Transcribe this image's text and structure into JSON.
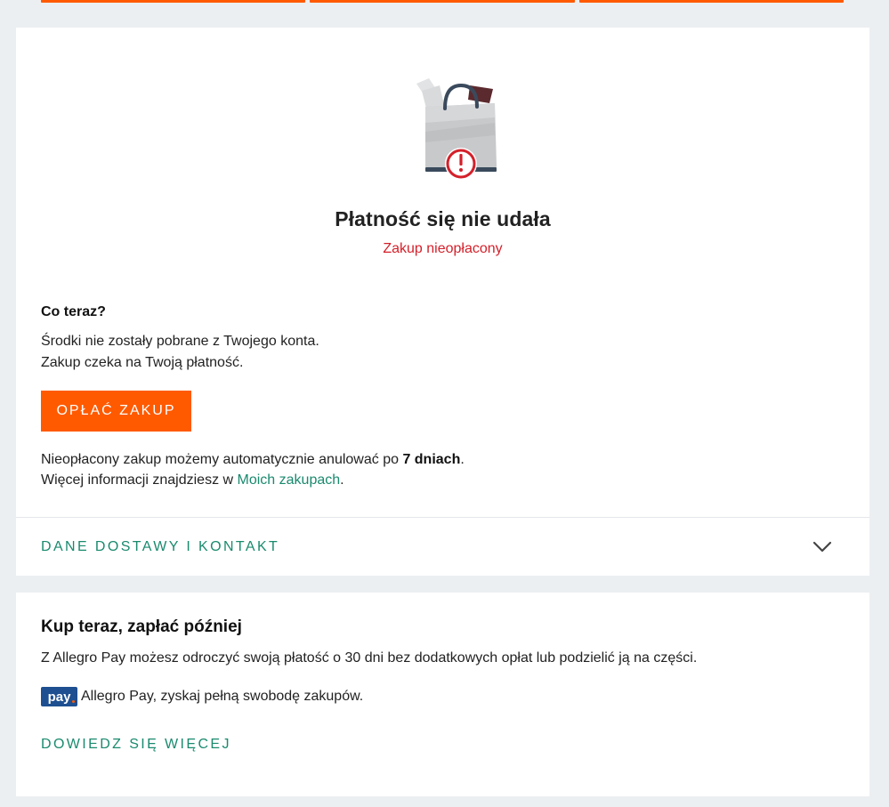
{
  "status": {
    "title": "Płatność się nie udała",
    "subtitle": "Zakup nieopłacony",
    "what_now_heading": "Co teraz?",
    "info_line1": "Środki nie zostały pobrane z Twojego konta.",
    "info_line2": "Zakup czeka na Twoją płatność.",
    "pay_button": "OPŁAĆ ZAKUP",
    "cancel_text_before": "Nieopłacony zakup możemy automatycznie anulować po ",
    "cancel_days": "7 dniach",
    "cancel_text_after": ".",
    "more_text_before": "Więcej informacji znajdziesz w ",
    "more_link": "Moich zakupach",
    "more_text_after": ".",
    "delivery_section": "DANE DOSTAWY I KONTAKT"
  },
  "allegro_pay": {
    "title": "Kup teraz, zapłać później",
    "description": "Z Allegro Pay możesz odroczyć swoją płatość o 30 dni bez dodatkowych opłat lub podzielić ją na części.",
    "logo_text": "pay",
    "promo": "Allegro Pay, zyskaj pełną swobodę zakupów.",
    "learn_more": "DOWIEDZ SIĘ WIĘCEJ"
  },
  "colors": {
    "accent": "#ff5a00",
    "link": "#1a8a6e",
    "error": "#d4202a",
    "pay_blue": "#1d4f91"
  },
  "icons": [
    "shopping-bag-error-illustration",
    "chevron-down-icon",
    "allegro-pay-logo"
  ]
}
